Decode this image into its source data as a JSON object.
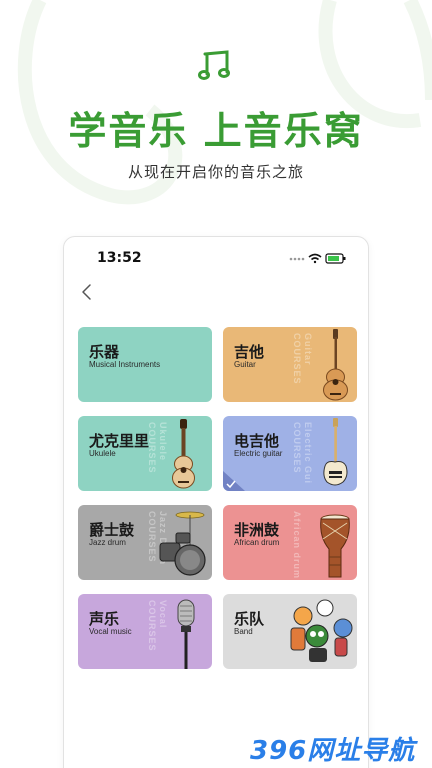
{
  "hero": {
    "title": "学音乐 上音乐窝",
    "subtitle": "从现在开启你的音乐之旅",
    "brand_color": "#3a9c34"
  },
  "status_bar": {
    "time": "13:52"
  },
  "cards": [
    {
      "cn": "乐器",
      "en": "Musical Instruments",
      "ghost": "",
      "color": "#8ed3c2",
      "icon": "none"
    },
    {
      "cn": "吉他",
      "en": "Guitar",
      "ghost": "Guitar COURSES",
      "color": "#e9b877",
      "icon": "acoustic-guitar-icon"
    },
    {
      "cn": "尤克里里",
      "en": "Ukulele",
      "ghost": "Ukulele COURSES",
      "color": "#8ed3c2",
      "icon": "ukulele-icon"
    },
    {
      "cn": "电吉他",
      "en": "Electric guitar",
      "ghost": "Electric Gui COURSES",
      "color": "#9fb1e6",
      "icon": "electric-guitar-icon"
    },
    {
      "cn": "爵士鼓",
      "en": "Jazz drum",
      "ghost": "Jazz Drum COURSES",
      "color": "#a8a8a8",
      "icon": "drum-kit-icon"
    },
    {
      "cn": "非洲鼓",
      "en": "African drum",
      "ghost": "African drum",
      "color": "#ec9292",
      "icon": "djembe-icon"
    },
    {
      "cn": "声乐",
      "en": "Vocal music",
      "ghost": "Vocal COURSES",
      "color": "#c7a7dc",
      "icon": "microphone-icon"
    },
    {
      "cn": "乐队",
      "en": "Band",
      "ghost": "",
      "color": "#dcdcdc",
      "icon": "band-characters-icon"
    }
  ],
  "watermark": "396网址导航"
}
